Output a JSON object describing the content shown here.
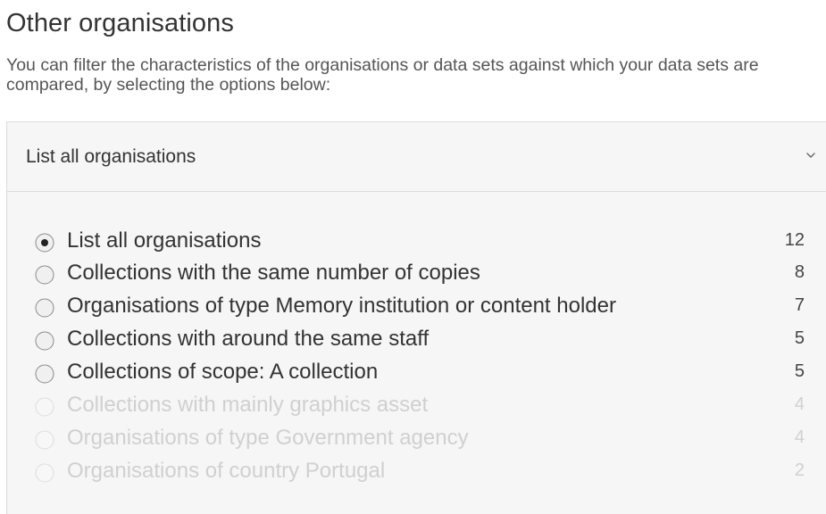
{
  "heading": "Other organisations",
  "intro": "You can filter the characteristics of the organisations or data sets against which your data sets are compared, by selecting the options below:",
  "dropdown": {
    "selected_label": "List all organisations",
    "icon": "chevron-down-icon"
  },
  "options": [
    {
      "label": "List all organisations",
      "count": "12",
      "selected": true,
      "disabled": false
    },
    {
      "label": "Collections with the same number of copies",
      "count": "8",
      "selected": false,
      "disabled": false
    },
    {
      "label": "Organisations of type Memory institution or content holder",
      "count": "7",
      "selected": false,
      "disabled": false
    },
    {
      "label": "Collections with around the same staff",
      "count": "5",
      "selected": false,
      "disabled": false
    },
    {
      "label": "Collections of scope: A collection",
      "count": "5",
      "selected": false,
      "disabled": false
    },
    {
      "label": "Collections with mainly graphics asset",
      "count": "4",
      "selected": false,
      "disabled": true
    },
    {
      "label": "Organisations of type Government agency",
      "count": "4",
      "selected": false,
      "disabled": true
    },
    {
      "label": "Organisations of country Portugal",
      "count": "2",
      "selected": false,
      "disabled": true
    }
  ],
  "colors": {
    "text": "#333333",
    "disabled_text": "#d0d0d0",
    "panel_background": "#f6f6f6",
    "border": "#dcdcdc"
  }
}
